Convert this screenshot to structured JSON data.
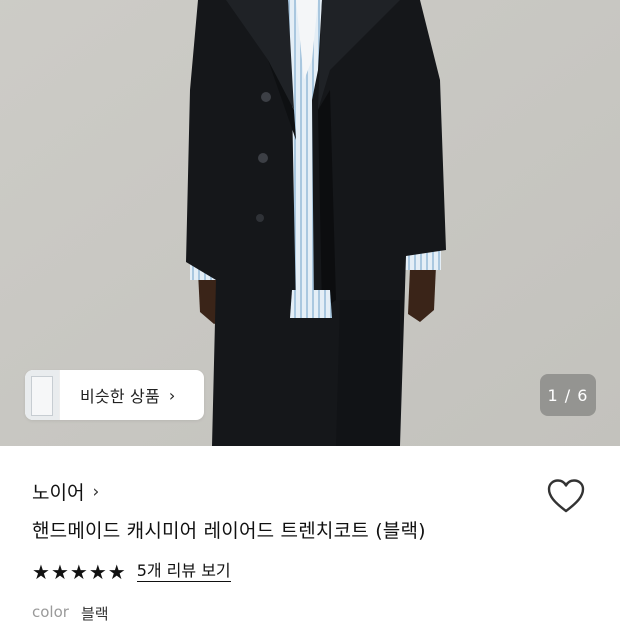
{
  "hero": {
    "similar_products_label": "비슷한 상품",
    "similar_chevron": "›",
    "image_counter": "1 / 6"
  },
  "product": {
    "brand": "노이어",
    "brand_chevron": "›",
    "title": "핸드메이드 캐시미어 레이어드 트렌치코트 (블랙)",
    "rating_stars": 5,
    "star_glyph": "★",
    "reviews_link": "5개 리뷰 보기",
    "color_label": "color",
    "color_value": "블랙"
  },
  "icons": {
    "wishlist": "heart-outline-icon",
    "chevron": "chevron-right-icon",
    "star": "star-filled-icon"
  },
  "colors": {
    "hero_background": "#c9c8c3",
    "coat": "#15171a",
    "shirt_stripe": "#a9c7df",
    "text_primary": "#111111",
    "text_muted": "#9a9a9a"
  }
}
